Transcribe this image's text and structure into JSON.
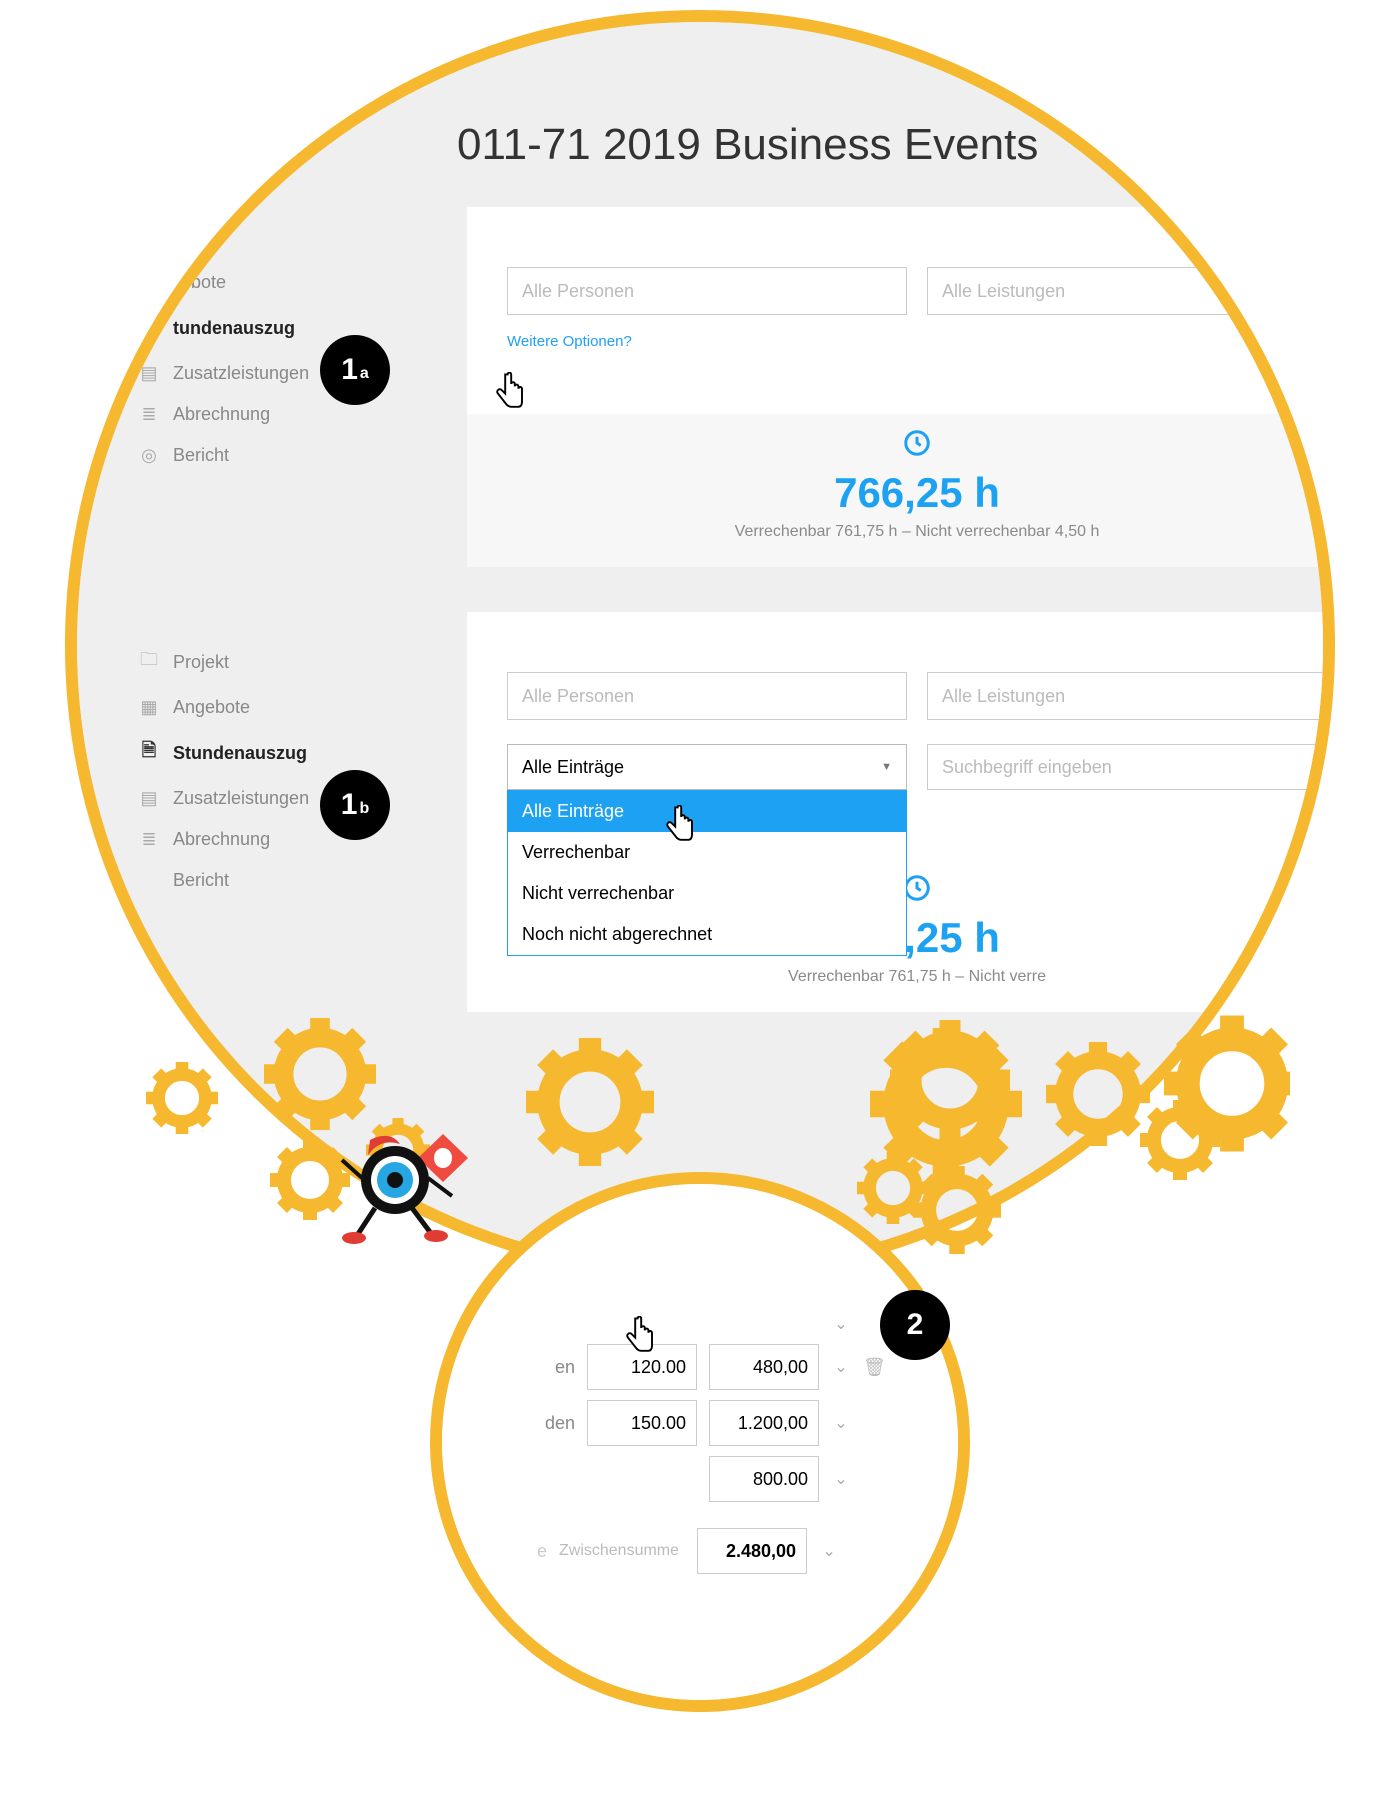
{
  "title": "011-71 2019 Business Events",
  "sidebar_top": {
    "items": [
      {
        "icon": "doc",
        "label": "…bote"
      },
      {
        "icon": "page",
        "label": "tundenauszug",
        "active": true
      },
      {
        "icon": "card",
        "label": "Zusatzleistungen"
      },
      {
        "icon": "db",
        "label": "Abrechnung"
      },
      {
        "icon": "target",
        "label": "Bericht"
      }
    ]
  },
  "sidebar_bottom": {
    "items": [
      {
        "icon": "folder",
        "label": "Projekt"
      },
      {
        "icon": "doc",
        "label": "Angebote"
      },
      {
        "icon": "page",
        "label": "Stundenauszug",
        "active": true
      },
      {
        "icon": "card",
        "label": "Zusatzleistungen"
      },
      {
        "icon": "db",
        "label": "Abrechnung"
      },
      {
        "icon": "",
        "label": "Bericht"
      }
    ]
  },
  "filters": {
    "persons_placeholder": "Alle Personen",
    "services_placeholder": "Alle Leistungen",
    "more_options": "Weitere Optionen?",
    "entries_selected": "Alle Einträge",
    "entries_options": [
      "Alle Einträge",
      "Verrechenbar",
      "Nicht verrechenbar",
      "Noch nicht abgerechnet"
    ],
    "search_placeholder": "Suchbegriff eingeben"
  },
  "kpi": {
    "value": "766,25 h",
    "sub": "Verrechenbar 761,75 h – Nicht verrechenbar 4,50 h",
    "sub_short": "Verrechenbar 761,75 h – Nicht verre"
  },
  "mini": {
    "rows": [
      {
        "label": "en",
        "rate": "120.00",
        "amount": "480,00"
      },
      {
        "label": "den",
        "rate": "150.00",
        "amount": "1.200,00"
      },
      {
        "label": "",
        "rate": "",
        "amount": "800.00"
      }
    ],
    "subtotal_label": "Zwischensumme",
    "subtotal_prefix": "e",
    "subtotal": "2.480,00"
  },
  "badges": {
    "a": "1",
    "asub": "a",
    "b": "1",
    "bsub": "b",
    "two": "2"
  },
  "colors": {
    "accent": "#1da1f2",
    "ring": "#f5b82e"
  }
}
